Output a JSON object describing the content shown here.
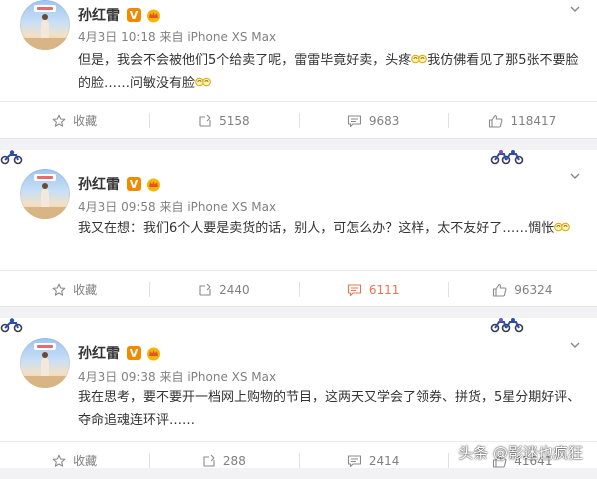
{
  "posts": [
    {
      "author": "孙红雷",
      "time": "4月3日 10:18",
      "source": "来自 iPhone XS Max",
      "text_1": "但是，我会不会被他们5个给卖了呢，雷雷毕竟好卖，头疼",
      "text_2": "我仿佛看见了那5张不要脸的脸……问敏没有脸",
      "collect_label": "收藏",
      "repost_count": "5158",
      "comment_count": "9683",
      "like_count": "118417"
    },
    {
      "author": "孙红雷",
      "time": "4月3日 09:58",
      "source": "来自 iPhone XS Max",
      "text_1": "我又在想：我们6个人要是卖货的话，别人，可怎么办？这样，太不友好了……惆怅",
      "collect_label": "收藏",
      "repost_count": "2440",
      "comment_count": "6111",
      "like_count": "96324"
    },
    {
      "author": "孙红雷",
      "time": "4月3日 09:38",
      "source": "来自 iPhone XS Max",
      "text_1": "我在思考，要不要开一档网上购物的节目，这两天又学会了领券、拼货，5星分期好评、夺命追魂连环评……",
      "collect_label": "收藏",
      "repost_count": "288",
      "comment_count": "2414",
      "like_count": "41641"
    }
  ],
  "watermark": "头条 @影迷也疯狂",
  "colors": {
    "verified_badge": "#f08a00",
    "highlight_count": "#eb7350",
    "text": "#333333",
    "meta": "#808080"
  },
  "icons": {
    "verified": "v-badge-icon",
    "member": "crown-icon",
    "collect": "star-icon",
    "repost": "repost-icon",
    "comment": "comment-icon",
    "like": "thumb-up-icon",
    "menu": "chevron-down-icon",
    "decor": "motorbike-icon"
  }
}
